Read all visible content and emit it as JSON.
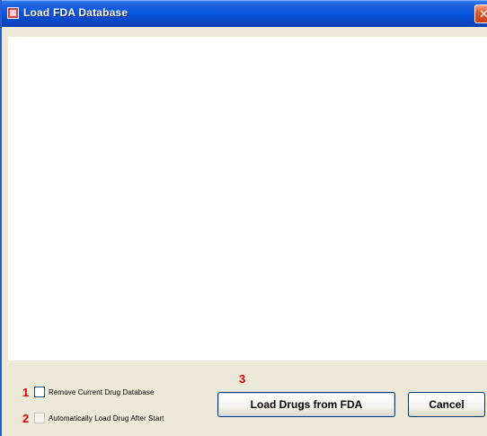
{
  "window": {
    "title": "Load FDA Database",
    "close_glyph": "✕",
    "icon": "app-window-icon"
  },
  "options": {
    "checkbox1_label": "Remove Current Drug Database",
    "checkbox2_label": "Automatically Load Drug After Start",
    "checkbox1_checked": false,
    "checkbox2_checked": false
  },
  "annotations": {
    "marker1": "1",
    "marker2": "2",
    "marker3": "3"
  },
  "buttons": {
    "load_label": "Load Drugs from FDA",
    "cancel_label": "Cancel"
  },
  "colors": {
    "titlebar": "#0a55db",
    "marker": "#e00000",
    "window_bg": "#ece9d8"
  }
}
